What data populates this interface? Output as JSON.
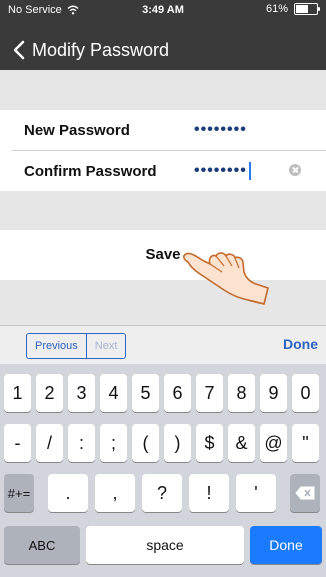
{
  "status_bar": {
    "carrier": "No Service",
    "time": "3:49 AM",
    "battery": "61%",
    "battery_level": 0.61
  },
  "nav": {
    "title": "Modify Password"
  },
  "form": {
    "new_password": {
      "label": "New Password",
      "value": "••••••••"
    },
    "confirm_password": {
      "label": "Confirm Password",
      "value": "••••••••"
    },
    "save_label": "Save"
  },
  "accessory_bar": {
    "previous": "Previous",
    "next": "Next",
    "done": "Done"
  },
  "keyboard": {
    "row1": [
      "1",
      "2",
      "3",
      "4",
      "5",
      "6",
      "7",
      "8",
      "9",
      "0"
    ],
    "row2": [
      "-",
      "/",
      ":",
      ";",
      "(",
      ")",
      "$",
      "&",
      "@",
      "\""
    ],
    "row3": {
      "shift": "#+=",
      "keys": [
        ".",
        ",",
        "?",
        "!",
        "'"
      ]
    },
    "row4": {
      "abc": "ABC",
      "space": "space",
      "done": "Done"
    }
  },
  "colors": {
    "accent": "#1b7bff",
    "nav_bg": "#3a3a3a"
  }
}
